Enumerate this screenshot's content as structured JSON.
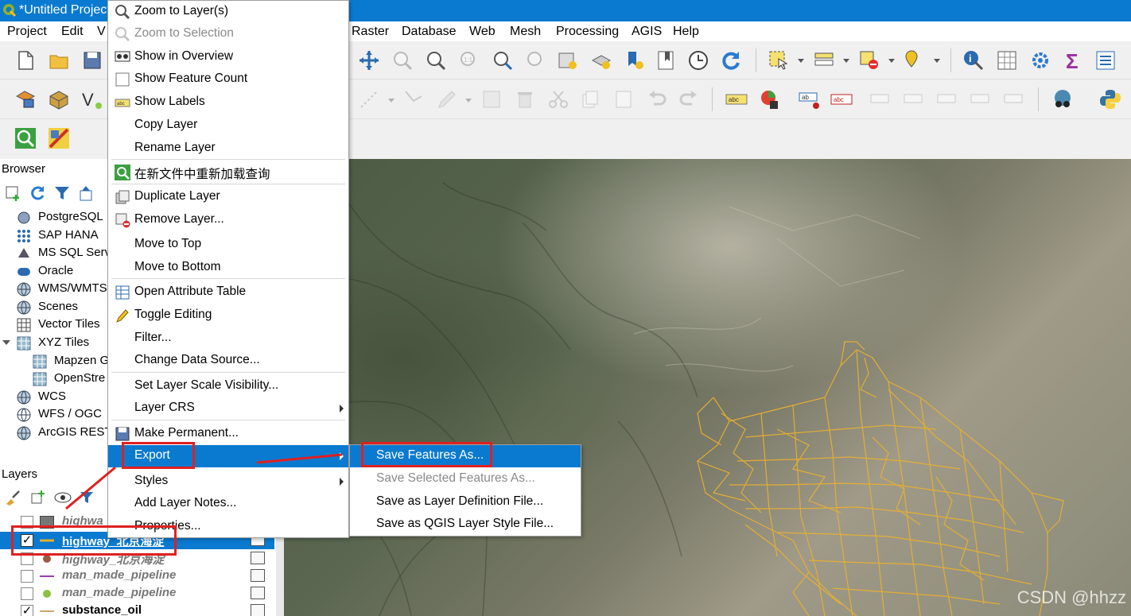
{
  "window": {
    "title": "*Untitled Project"
  },
  "menubar": [
    "Project",
    "Edit",
    "V",
    "Raster",
    "Database",
    "Web",
    "Mesh",
    "Processing",
    "AGIS",
    "Help"
  ],
  "browser": {
    "title": "Browser",
    "items": [
      {
        "label": "PostgreSQL",
        "icon": "postgresql-elephant-icon",
        "indent": 0
      },
      {
        "label": "SAP HANA",
        "icon": "sap-hana-grid-icon",
        "indent": 0
      },
      {
        "label": "MS SQL Serv",
        "icon": "mssql-icon",
        "indent": 0
      },
      {
        "label": "Oracle",
        "icon": "oracle-icon",
        "indent": 0
      },
      {
        "label": "WMS/WMTS",
        "icon": "globe-icon",
        "indent": 0
      },
      {
        "label": "Scenes",
        "icon": "globe-icon",
        "indent": 0
      },
      {
        "label": "Vector Tiles",
        "icon": "grid-icon",
        "indent": 0
      },
      {
        "label": "XYZ Tiles",
        "icon": "grid-icon",
        "indent": 0
      },
      {
        "label": "Mapzen G",
        "icon": "grid-icon",
        "indent": 1
      },
      {
        "label": "OpenStre",
        "icon": "grid-icon",
        "indent": 1
      },
      {
        "label": "WCS",
        "icon": "globe-icon",
        "indent": 0
      },
      {
        "label": "WFS / OGC",
        "icon": "wfs-icon",
        "indent": 0
      },
      {
        "label": "ArcGIS REST",
        "icon": "globe-icon",
        "indent": 0
      }
    ]
  },
  "layers": {
    "title": "Layers",
    "rows": [
      {
        "label": "highwa",
        "checked": false,
        "symbol": "polygon"
      },
      {
        "label": "highway_北京海淀",
        "checked": true,
        "symbol": "line-orange",
        "selected": true
      },
      {
        "label": "highway_北京海淀",
        "checked": false,
        "symbol": "point-brown"
      },
      {
        "label": "man_made_pipeline",
        "checked": false,
        "symbol": "line-purple"
      },
      {
        "label": "man_made_pipeline",
        "checked": false,
        "symbol": "point-green"
      },
      {
        "label": "substance_oil",
        "checked": true,
        "symbol": "line-tan"
      }
    ]
  },
  "context_menu": {
    "items": [
      {
        "label": "Zoom to Layer(s)",
        "icon": "zoom-layer-icon",
        "disabled": false
      },
      {
        "label": "Zoom to Selection",
        "icon": "zoom-selection-icon",
        "disabled": true
      },
      {
        "label": "Show in Overview",
        "icon": "overview-icon",
        "disabled": false
      },
      {
        "label": "Show Feature Count",
        "icon": "checkbox-icon",
        "disabled": false
      },
      {
        "label": "Show Labels",
        "icon": "labels-icon",
        "disabled": false
      },
      {
        "label": "Copy Layer",
        "icon": "",
        "disabled": false
      },
      {
        "label": "Rename Layer",
        "icon": "",
        "disabled": false
      },
      {
        "label": "在新文件中重新加载查询",
        "icon": "reload-query-icon",
        "disabled": false
      },
      {
        "label": "Duplicate Layer",
        "icon": "duplicate-icon",
        "disabled": false
      },
      {
        "label": "Remove Layer...",
        "icon": "remove-layer-icon",
        "disabled": false
      },
      {
        "label": "Move to Top",
        "icon": "",
        "disabled": false
      },
      {
        "label": "Move to Bottom",
        "icon": "",
        "disabled": false
      },
      {
        "label": "Open Attribute Table",
        "icon": "table-icon",
        "disabled": false
      },
      {
        "label": "Toggle Editing",
        "icon": "pencil-icon",
        "disabled": false
      },
      {
        "label": "Filter...",
        "icon": "",
        "disabled": false
      },
      {
        "label": "Change Data Source...",
        "icon": "",
        "disabled": false
      },
      {
        "label": "Set Layer Scale Visibility...",
        "icon": "",
        "disabled": false
      },
      {
        "label": "Layer CRS",
        "icon": "",
        "disabled": false,
        "submenu": true
      },
      {
        "label": "Make Permanent...",
        "icon": "save-icon",
        "disabled": false
      },
      {
        "label": "Export",
        "icon": "",
        "disabled": false,
        "submenu": true,
        "highlighted": true
      },
      {
        "label": "Styles",
        "icon": "",
        "disabled": false,
        "submenu": true
      },
      {
        "label": "Add Layer Notes...",
        "icon": "",
        "disabled": false
      },
      {
        "label": "Properties...",
        "icon": "",
        "disabled": false
      }
    ]
  },
  "export_submenu": {
    "items": [
      {
        "label": "Save Features As...",
        "disabled": false,
        "highlighted": true
      },
      {
        "label": "Save Selected Features As...",
        "disabled": true
      },
      {
        "label": "Save as Layer Definition File...",
        "disabled": false
      },
      {
        "label": "Save as QGIS Layer Style File...",
        "disabled": false
      }
    ]
  },
  "watermark": "CSDN @hhzz",
  "colors": {
    "accent": "#0a7ad0",
    "highlight": "#0a7ad0",
    "annotation": "#e02020",
    "roads": "#e8b030"
  }
}
